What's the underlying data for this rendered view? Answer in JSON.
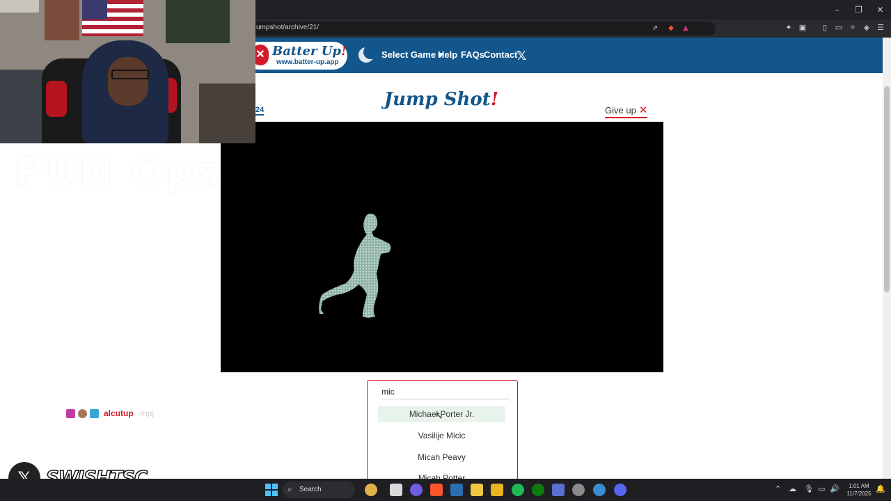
{
  "browser": {
    "url": "umpshot/archive/21/",
    "window_controls": [
      "–",
      "❐",
      "✕"
    ]
  },
  "site": {
    "logo_title": "Batter Up",
    "logo_bang": "!",
    "logo_url": "www.batter-up.app",
    "nav": {
      "select_game": "Select Game ▾",
      "help": "Help",
      "faqs": "FAQs",
      "contact": "Contact",
      "x_icon": "𝕏"
    }
  },
  "game": {
    "title": "Jump Shot",
    "title_bang": "!",
    "archive_number": "24",
    "give_up": "Give up",
    "give_up_icon": "✕"
  },
  "search": {
    "value": "mic",
    "suggestions": [
      "Michael Porter Jr.",
      "Vasilije Micic",
      "Micah Peavy",
      "Micah Potter"
    ],
    "highlighted_index": 0
  },
  "stream": {
    "overlay_text": "PUN Ops",
    "chat": {
      "username": "alcutup",
      "message": "mpj"
    },
    "social_handle": "SWISHTSC",
    "social_icon": "𝕏"
  },
  "taskbar": {
    "search_label": "Search",
    "time": "1:01 AM",
    "date": "11/7/2025"
  },
  "colors": {
    "header_blue": "#13568c",
    "accent_red": "#d11a2a",
    "canvas_black": "#000000",
    "highlight_green": "#e8f3ec"
  }
}
